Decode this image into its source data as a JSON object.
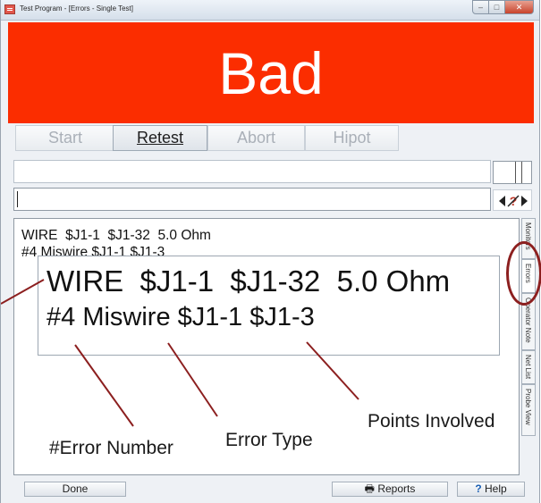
{
  "window": {
    "title": "Test Program - [Errors - Single Test]"
  },
  "status": {
    "banner_text": "Bad",
    "banner_color": "#fb2d00"
  },
  "toolbar": {
    "start_label": "Start",
    "retest_label": "Retest",
    "abort_label": "Abort",
    "hipot_label": "Hipot"
  },
  "fields": {
    "top_value": "",
    "bottom_value": ""
  },
  "errors": {
    "line1": "WIRE  $J1-1  $J1-32  5.0 Ohm",
    "line2": "#4 Miswire $J1-1 $J1-3"
  },
  "zoom": {
    "line1": "WIRE  $J1-1  $J1-32  5.0 Ohm",
    "line2": "#4 Miswire $J1-1 $J1-3"
  },
  "side_tabs": [
    "Monitors",
    "Errors",
    "Operator Note",
    "Net List",
    "Probe View"
  ],
  "annotations": {
    "error_number": "#Error Number",
    "error_type": "Error Type",
    "points_involved": "Points Involved",
    "annotation_color": "#8c1f1f"
  },
  "footer": {
    "done_label": "Done",
    "reports_label": "Reports",
    "help_label": "Help"
  },
  "icons": {
    "app": "app-icon",
    "nav_arrows": "arrows-question-icon",
    "reports": "printer-icon",
    "help": "question-icon"
  }
}
